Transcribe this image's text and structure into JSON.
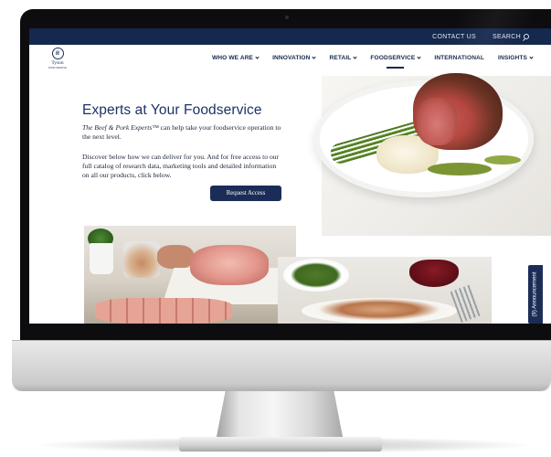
{
  "topbar": {
    "contact_label": "CONTACT US",
    "search_label": "SEARCH"
  },
  "logo": {
    "mark": "ff",
    "wordmark": "Tyson",
    "tagline": "FOOD SERVICE"
  },
  "nav": {
    "items": [
      {
        "label": "WHO WE ARE",
        "has_dropdown": true
      },
      {
        "label": "INNOVATION",
        "has_dropdown": true
      },
      {
        "label": "RETAIL",
        "has_dropdown": true
      },
      {
        "label": "FOODSERVICE",
        "has_dropdown": true,
        "active": true
      },
      {
        "label": "INTERNATIONAL",
        "has_dropdown": false
      },
      {
        "label": "INSIGHTS",
        "has_dropdown": true
      }
    ]
  },
  "hero": {
    "title": "Experts at Your Foodservice",
    "intro_brand": "The Beef & Pork Experts™",
    "intro_rest": " can help take your foodservice operation to the next level.",
    "body": "Discover below how we can deliver for you. And for free access to our full catalog of research data, marketing tools and detailed information on all our products, click below.",
    "cta_label": "Request Access"
  },
  "announcement_tab": {
    "label": "(9) Announcement"
  },
  "colors": {
    "navy": "#15284d",
    "button": "#1b2d57",
    "title_blue": "#1d3266"
  },
  "icons": {
    "search": "search-icon",
    "chevron": "chevron-down-icon"
  }
}
